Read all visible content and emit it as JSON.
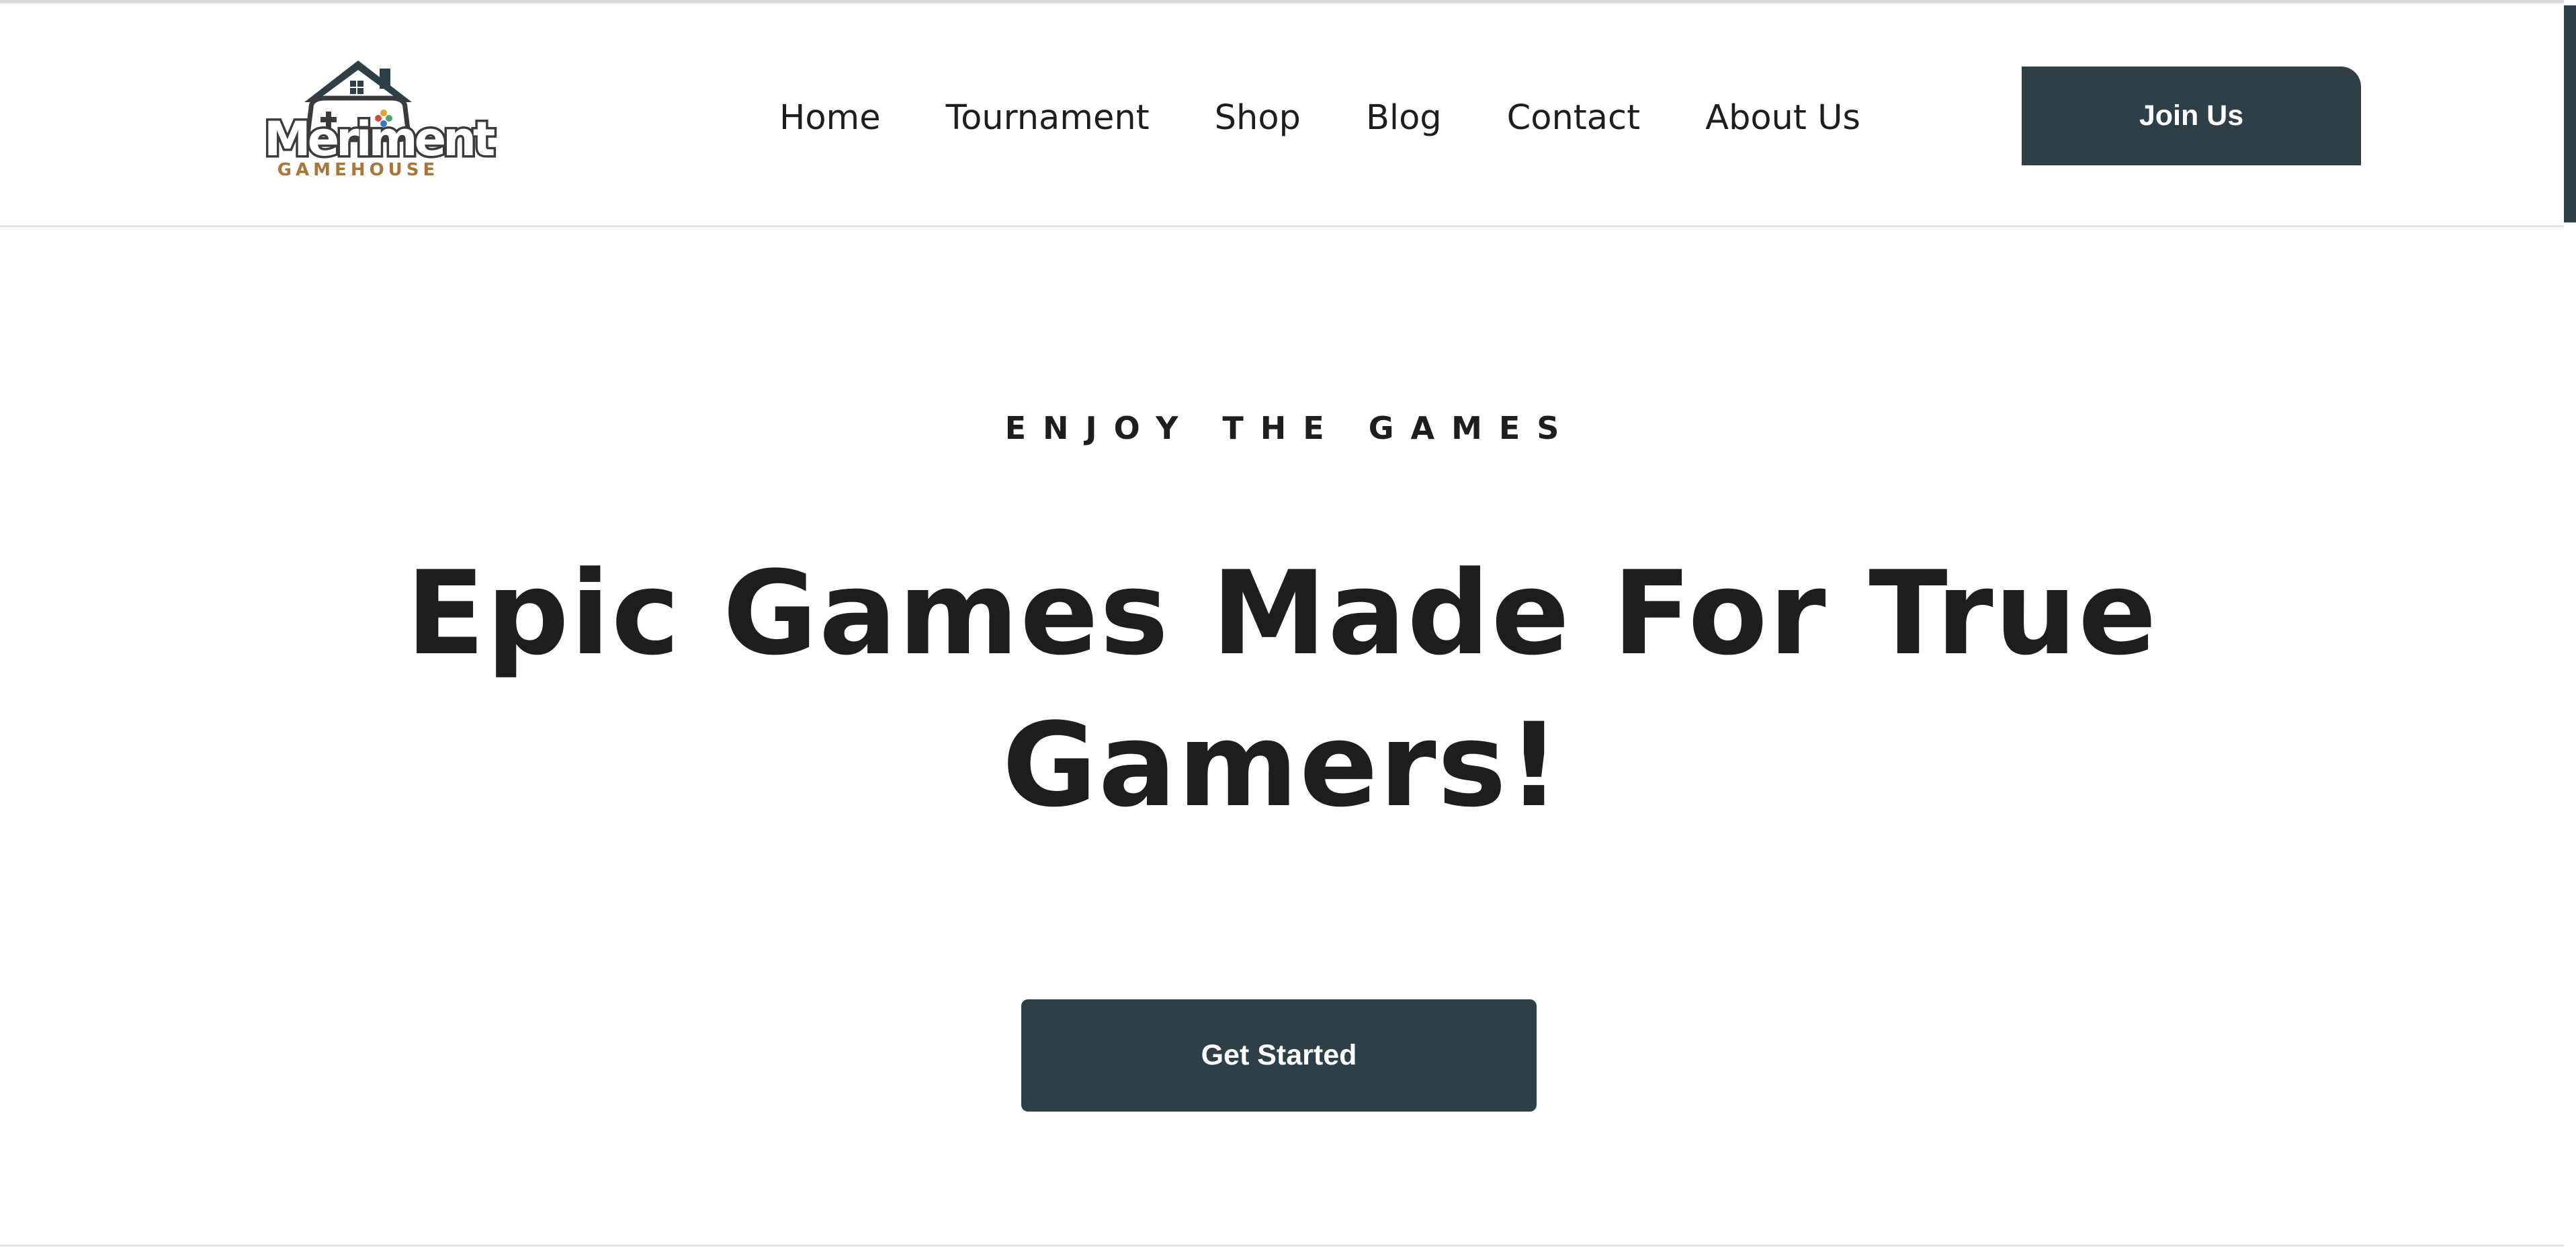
{
  "header": {
    "logo": {
      "word": "Meriment",
      "sub": "GAMEHOUSE",
      "icon": "house-gamepad-icon"
    },
    "nav": [
      {
        "label": "Home"
      },
      {
        "label": "Tournament"
      },
      {
        "label": "Shop"
      },
      {
        "label": "Blog"
      },
      {
        "label": "Contact"
      },
      {
        "label": "About Us"
      }
    ],
    "join_label": "Join Us"
  },
  "hero": {
    "eyebrow": "ENJOY THE GAMES",
    "headline": "Epic Games Made For True Gamers!",
    "cta_label": "Get Started"
  },
  "colors": {
    "primary": "#2f3f48",
    "text": "#1e1e1e",
    "logo_accent": "#a9773c"
  }
}
